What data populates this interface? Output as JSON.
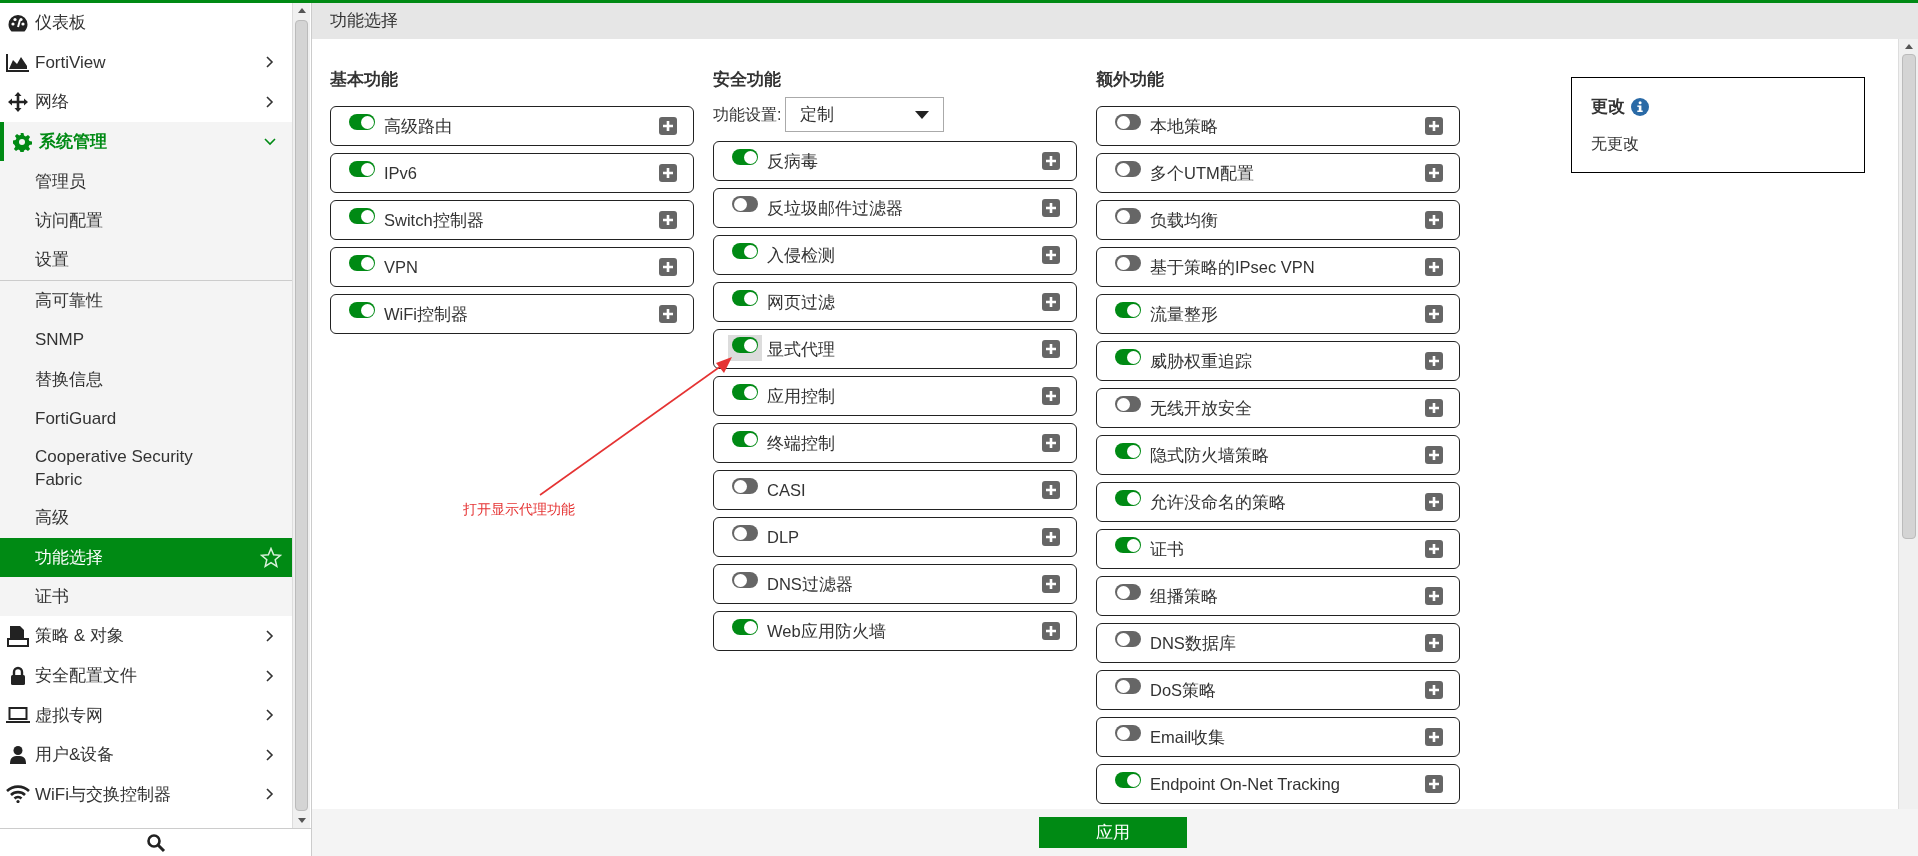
{
  "sidebar": {
    "items": [
      {
        "label": "仪表板"
      },
      {
        "label": "FortiView",
        "expanded": false
      },
      {
        "label": "网络",
        "expanded": false
      },
      {
        "label": "系统管理",
        "expanded": true,
        "child_groups": [
          {
            "items": [
              {
                "label": "管理员",
                "selected": false
              },
              {
                "label": "访问配置",
                "selected": false
              },
              {
                "label": "设置",
                "selected": false
              }
            ]
          },
          {
            "items": [
              {
                "label": "高可靠性",
                "selected": false
              },
              {
                "label": "SNMP",
                "selected": false
              },
              {
                "label": "替换信息",
                "selected": false
              },
              {
                "label": "FortiGuard",
                "selected": false
              },
              {
                "label": "Cooperative Security Fabric",
                "selected": false
              },
              {
                "label": "高级",
                "selected": false
              },
              {
                "label": "功能选择",
                "selected": true
              },
              {
                "label": "证书",
                "selected": false
              }
            ]
          }
        ]
      },
      {
        "label": "策略 & 对象",
        "expanded": false
      },
      {
        "label": "安全配置文件",
        "expanded": false
      },
      {
        "label": "虚拟专网",
        "expanded": false
      },
      {
        "label": "用户&设备",
        "expanded": false
      },
      {
        "label": "WiFi与交换控制器",
        "expanded": false
      }
    ]
  },
  "page_title": "功能选择",
  "columns": [
    {
      "heading": "基本功能",
      "features": [
        {
          "label": "高级路由",
          "on": true,
          "highlighted": false
        },
        {
          "label": "IPv6",
          "on": true,
          "highlighted": false
        },
        {
          "label": "Switch控制器",
          "on": true,
          "highlighted": false
        },
        {
          "label": "VPN",
          "on": true,
          "highlighted": false
        },
        {
          "label": "WiFi控制器",
          "on": true,
          "highlighted": false
        }
      ]
    },
    {
      "heading": "安全功能",
      "setting": {
        "label": "功能设置:",
        "value": "定制"
      },
      "features": [
        {
          "label": "反病毒",
          "on": true,
          "highlighted": false
        },
        {
          "label": "反垃圾邮件过滤器",
          "on": false,
          "highlighted": false
        },
        {
          "label": "入侵检测",
          "on": true,
          "highlighted": false
        },
        {
          "label": "网页过滤",
          "on": true,
          "highlighted": false
        },
        {
          "label": "显式代理",
          "on": true,
          "highlighted": true
        },
        {
          "label": "应用控制",
          "on": true,
          "highlighted": false
        },
        {
          "label": "终端控制",
          "on": true,
          "highlighted": false
        },
        {
          "label": "CASI",
          "on": false,
          "highlighted": false
        },
        {
          "label": "DLP",
          "on": false,
          "highlighted": false
        },
        {
          "label": "DNS过滤器",
          "on": false,
          "highlighted": false
        },
        {
          "label": "Web应用防火墙",
          "on": true,
          "highlighted": false
        }
      ]
    },
    {
      "heading": "额外功能",
      "features": [
        {
          "label": "本地策略",
          "on": false,
          "highlighted": false
        },
        {
          "label": "多个UTM配置",
          "on": false,
          "highlighted": false
        },
        {
          "label": "负载均衡",
          "on": false,
          "highlighted": false
        },
        {
          "label": "基于策略的IPsec VPN",
          "on": false,
          "highlighted": false
        },
        {
          "label": "流量整形",
          "on": true,
          "highlighted": false
        },
        {
          "label": "威胁权重追踪",
          "on": true,
          "highlighted": false
        },
        {
          "label": "无线开放安全",
          "on": false,
          "highlighted": false
        },
        {
          "label": "隐式防火墙策略",
          "on": true,
          "highlighted": false
        },
        {
          "label": "允许没命名的策略",
          "on": true,
          "highlighted": false
        },
        {
          "label": "证书",
          "on": true,
          "highlighted": false
        },
        {
          "label": "组播策略",
          "on": false,
          "highlighted": false
        },
        {
          "label": "DNS数据库",
          "on": false,
          "highlighted": false
        },
        {
          "label": "DoS策略",
          "on": false,
          "highlighted": false
        },
        {
          "label": "Email收集",
          "on": false,
          "highlighted": false
        },
        {
          "label": "Endpoint On-Net Tracking",
          "on": true,
          "highlighted": false
        }
      ]
    }
  ],
  "changes_panel": {
    "title": "更改",
    "text": "无更改"
  },
  "apply_button": "应用",
  "annotation": {
    "text": "打开显示代理功能"
  }
}
